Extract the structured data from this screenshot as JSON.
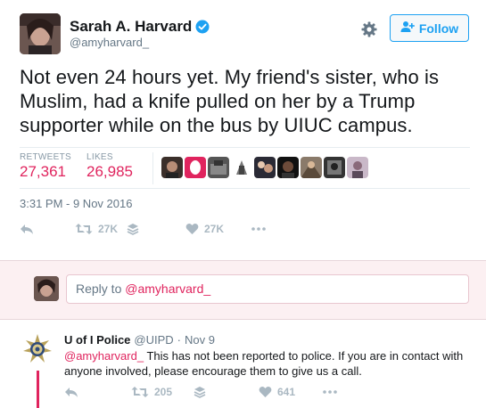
{
  "tweet": {
    "author_name": "Sarah A. Harvard",
    "author_handle": "@amyharvard_",
    "follow_label": "Follow",
    "text": "Not even 24 hours yet. My friend's sister, who is Muslim, had a knife pulled on her by a Trump supporter while on the bus by UIUC campus.",
    "retweets_label": "RETWEETS",
    "retweets_count": "27,361",
    "likes_label": "LIKES",
    "likes_count": "26,985",
    "timestamp": "3:31 PM - 9 Nov 2016",
    "action_retweet_count": "27K",
    "action_like_count": "27K",
    "liker_avatar_count": 9
  },
  "reply_box": {
    "prefix": "Reply to ",
    "mention": "@amyharvard_"
  },
  "reply": {
    "author_name": "U of I Police",
    "author_handle": "@UIPD",
    "separator": "·",
    "date": "Nov 9",
    "mention": "@amyharvard_",
    "text": " This has not been reported to police. If you are in contact with anyone involved, please encourage them to give us a call.",
    "retweet_count": "205",
    "like_count": "641"
  },
  "colors": {
    "accent": "#1da1f2",
    "highlight": "#e0245e",
    "muted": "#657786",
    "reply_bg": "#fcf0f2"
  },
  "icons": [
    "verified-badge-icon",
    "gear-icon",
    "add-user-icon",
    "reply-icon",
    "retweet-icon",
    "stack-icon",
    "heart-icon",
    "more-icon"
  ]
}
